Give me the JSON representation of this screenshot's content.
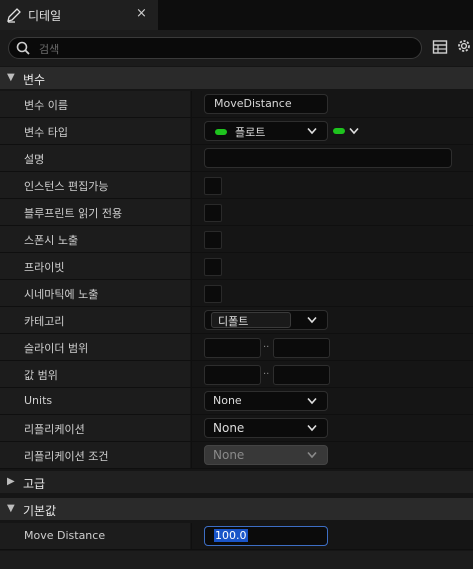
{
  "tab": {
    "title": "디테일",
    "close": "×"
  },
  "search": {
    "placeholder": "검색"
  },
  "sections": {
    "variable": "변수",
    "advanced": "고급",
    "default_value": "기본값"
  },
  "properties": {
    "variable_name": {
      "label": "변수 이름",
      "value": "MoveDistance"
    },
    "variable_type": {
      "label": "변수 타입",
      "value": "플로트",
      "pin_color": "#1ec31e"
    },
    "description": {
      "label": "설명",
      "value": ""
    },
    "instance_editable": {
      "label": "인스턴스 편집가능",
      "checked": false
    },
    "blueprint_read_only": {
      "label": "블루프린트 읽기 전용",
      "checked": false
    },
    "expose_on_spawn": {
      "label": "스폰시 노출",
      "checked": false
    },
    "private": {
      "label": "프라이빗",
      "checked": false
    },
    "expose_to_cinematics": {
      "label": "시네마틱에 노출",
      "checked": false
    },
    "category": {
      "label": "카테고리",
      "value": "디폴트"
    },
    "slider_range": {
      "label": "슬라이더 범위",
      "separator": ".."
    },
    "value_range": {
      "label": "값 범위",
      "separator": ".."
    },
    "units": {
      "label": "Units",
      "value": "None"
    },
    "replication": {
      "label": "리플리케이션",
      "value": "None"
    },
    "replication_condition": {
      "label": "리플리케이션 조건",
      "value": "None"
    }
  },
  "default_value": {
    "label": "Move Distance",
    "value": "100.0"
  },
  "colors": {
    "accent_selection": "#1a55c8",
    "float_pin": "#1ec31e"
  },
  "icons": [
    "pencil-icon",
    "search-icon",
    "grid-icon",
    "gear-icon",
    "chevron-down-icon",
    "caret-down-icon",
    "caret-right-icon"
  ]
}
